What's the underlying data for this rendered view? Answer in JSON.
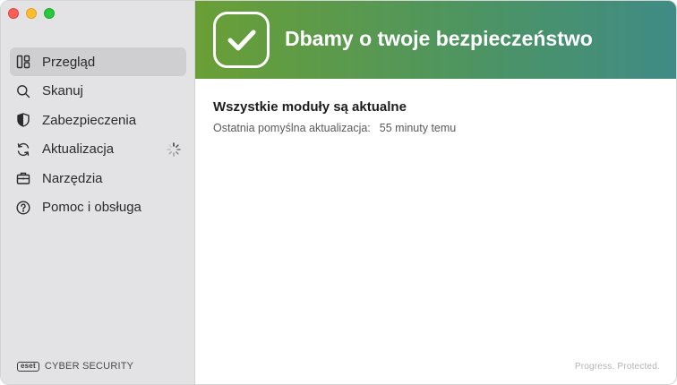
{
  "window": {
    "controls": [
      "close",
      "minimize",
      "zoom"
    ]
  },
  "sidebar": {
    "items": [
      {
        "label": "Przegląd",
        "icon": "layout-icon",
        "active": true
      },
      {
        "label": "Skanuj",
        "icon": "search-icon",
        "active": false
      },
      {
        "label": "Zabezpieczenia",
        "icon": "shield-icon",
        "active": false
      },
      {
        "label": "Aktualizacja",
        "icon": "refresh-icon",
        "active": false,
        "status": "updating"
      },
      {
        "label": "Narzędzia",
        "icon": "briefcase-icon",
        "active": false
      },
      {
        "label": "Pomoc i obsługa",
        "icon": "help-icon",
        "active": false
      }
    ],
    "brand": {
      "logo": "eset",
      "product": "CYBER SECURITY"
    }
  },
  "banner": {
    "icon": "checkmark-icon",
    "title": "Dbamy o twoje bezpieczeństwo",
    "colors": {
      "start": "#6a9f35",
      "end": "#3f8b86"
    }
  },
  "main": {
    "title": "Wszystkie moduły są aktualne",
    "last_update_label": "Ostatnia pomyślna aktualizacja:",
    "last_update_value": "55 minuty temu"
  },
  "footer": {
    "tagline": "Progress. Protected."
  }
}
